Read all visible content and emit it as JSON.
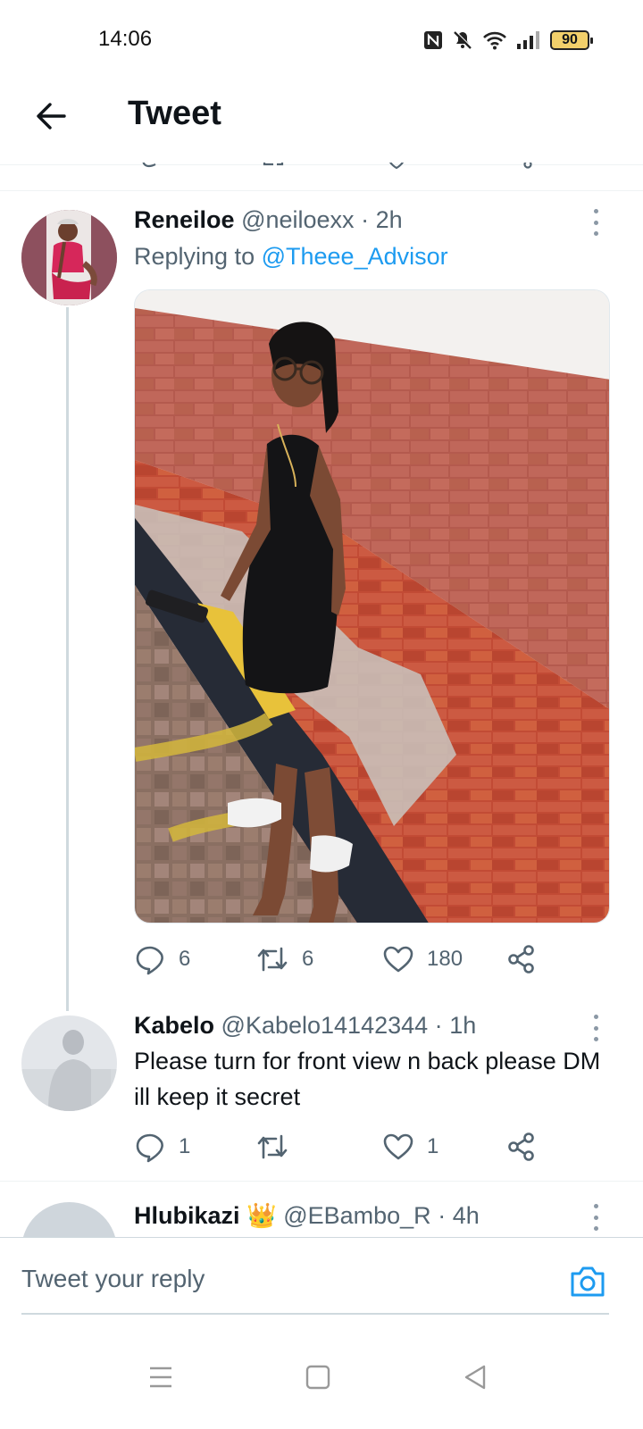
{
  "status_bar": {
    "time": "14:06",
    "battery": "90",
    "icons": [
      "nfc-icon",
      "mute-icon",
      "wifi-icon",
      "signal-icon",
      "battery-icon"
    ]
  },
  "header": {
    "title": "Tweet",
    "back_icon": "arrow-left-icon"
  },
  "tweets": [
    {
      "name": "Reneiloe",
      "handle": "@neiloexx",
      "separator": "·",
      "time": "2h",
      "replying_prefix": "Replying to",
      "replying_to": "@Theee_Advisor",
      "media": "photo",
      "replies": "6",
      "retweets": "6",
      "likes": "180"
    },
    {
      "name": "Kabelo",
      "handle": "@Kabelo14142344",
      "separator": "·",
      "time": "1h",
      "text": "Please turn for front view n back please DM ill keep it secret",
      "replies": "1",
      "retweets": "",
      "likes": "1"
    },
    {
      "name": "Hlubikazi",
      "emoji": "👑",
      "handle": "@EBambo_R",
      "separator": "·",
      "time": "4h"
    }
  ],
  "reply_bar": {
    "placeholder": "Tweet your reply",
    "icon": "camera-icon"
  },
  "colors": {
    "accent": "#1d9bf0",
    "text_primary": "#0f1419",
    "text_secondary": "#536471",
    "divider": "#eff3f4"
  }
}
